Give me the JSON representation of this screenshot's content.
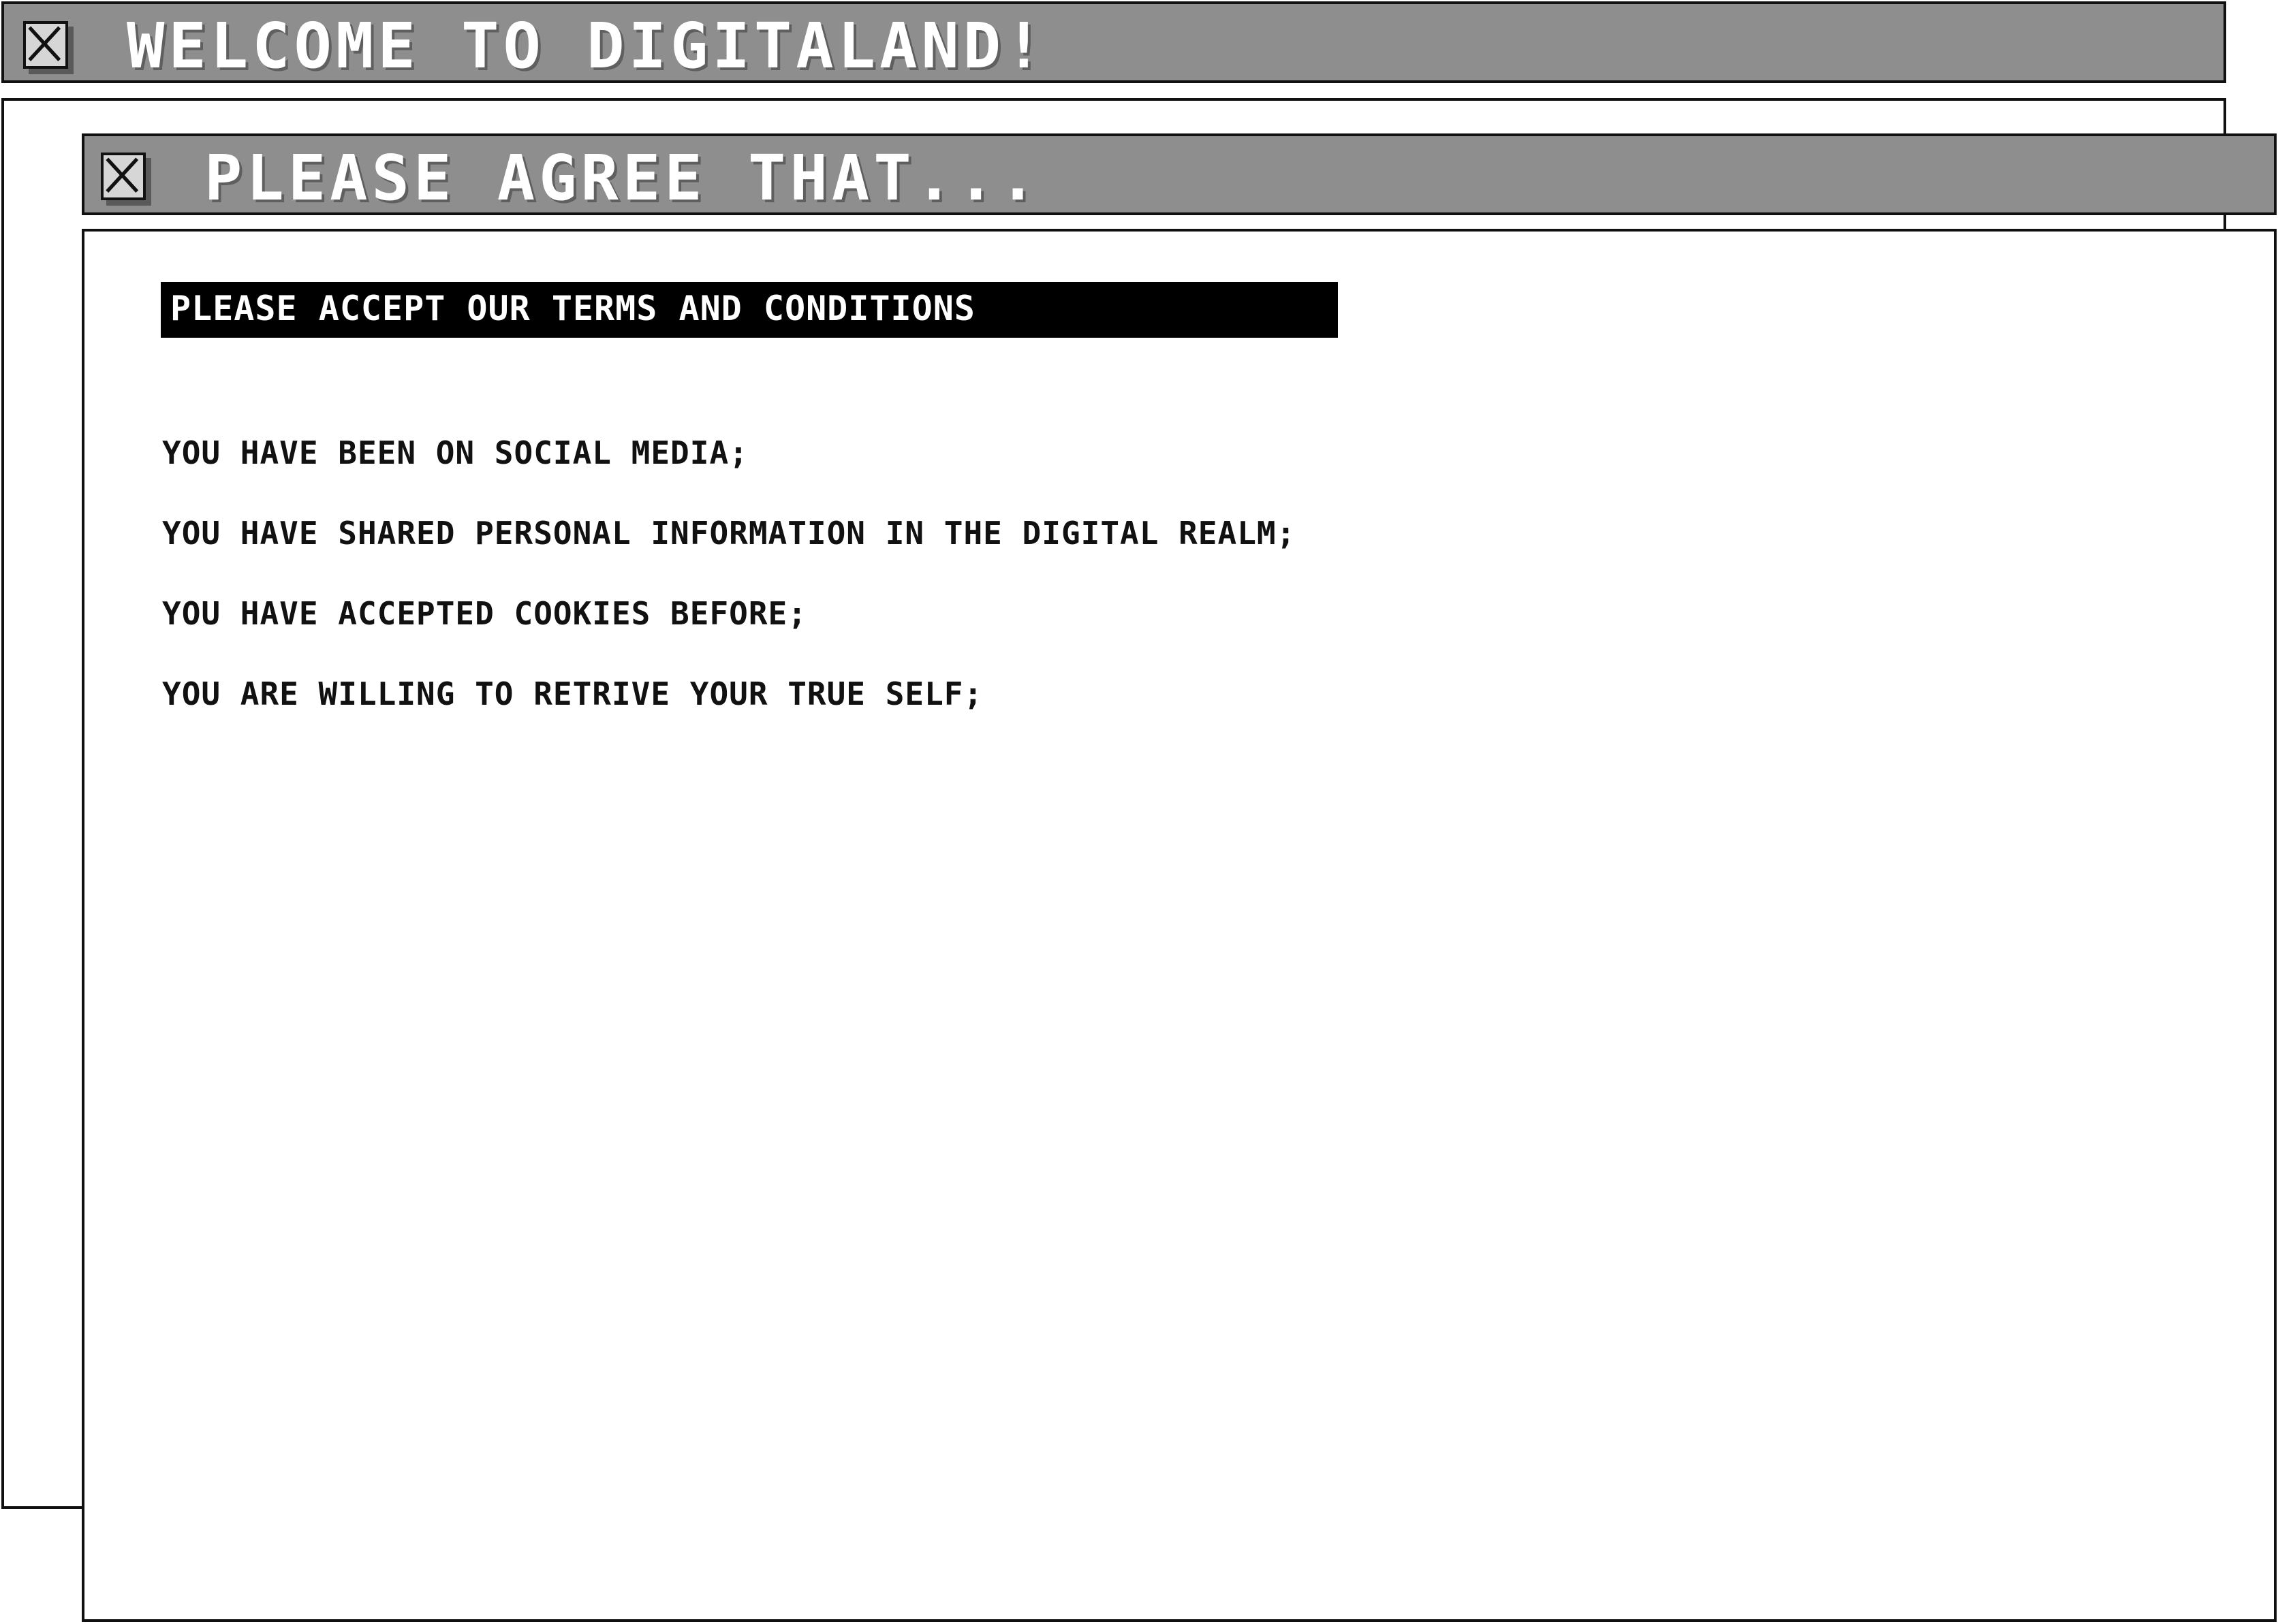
{
  "back_window": {
    "title": "WELCOME TO DIGITALAND!",
    "close_icon": "close-x-icon"
  },
  "front_window": {
    "title": "PLEASE AGREE THAT...",
    "close_icon": "close-x-icon",
    "heading": "PLEASE ACCEPT OUR TERMS AND CONDITIONS",
    "terms": [
      "YOU HAVE BEEN ON SOCIAL MEDIA;",
      "YOU HAVE SHARED PERSONAL INFORMATION IN THE DIGITAL REALM;",
      "YOU HAVE ACCEPTED COOKIES BEFORE;",
      "YOU ARE WILLING TO RETRIVE YOUR TRUE SELF;"
    ]
  },
  "colors": {
    "titlebar": "#8e8e8e",
    "border": "#111111",
    "heading_bg": "#000000",
    "heading_text": "#ffffff",
    "body_bg": "#ffffff"
  }
}
